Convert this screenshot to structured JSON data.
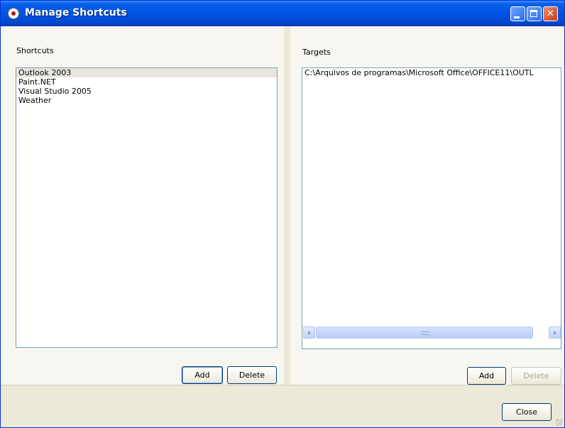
{
  "window": {
    "title": "Manage Shortcuts",
    "controls": {
      "minimize": "",
      "maximize": "",
      "close": "✕"
    }
  },
  "shortcuts": {
    "label": "Shortcuts",
    "items": [
      "Outlook 2003",
      "Paint.NET",
      "Visual Studio 2005",
      "Weather"
    ],
    "selected": "Outlook 2003",
    "add_label": "Add",
    "delete_label": "Delete"
  },
  "targets": {
    "label": "Targets",
    "items": [
      "C:\\Arquivos de programas\\Microsoft Office\\OFFICE11\\OUTL"
    ],
    "add_label": "Add",
    "delete_label": "Delete",
    "scroll_left": "‹",
    "scroll_right": "›"
  },
  "footer": {
    "close_label": "Close"
  },
  "colors": {
    "titlebar": "#0054e3",
    "window_bg": "#ece9d8",
    "panel_bg": "#f7f6f1",
    "list_border": "#7f9db9",
    "selected_item": "#e8e6de"
  },
  "icons": {
    "app": "app-icon",
    "minimize": "minimize-icon",
    "maximize": "maximize-icon",
    "close": "close-icon"
  }
}
